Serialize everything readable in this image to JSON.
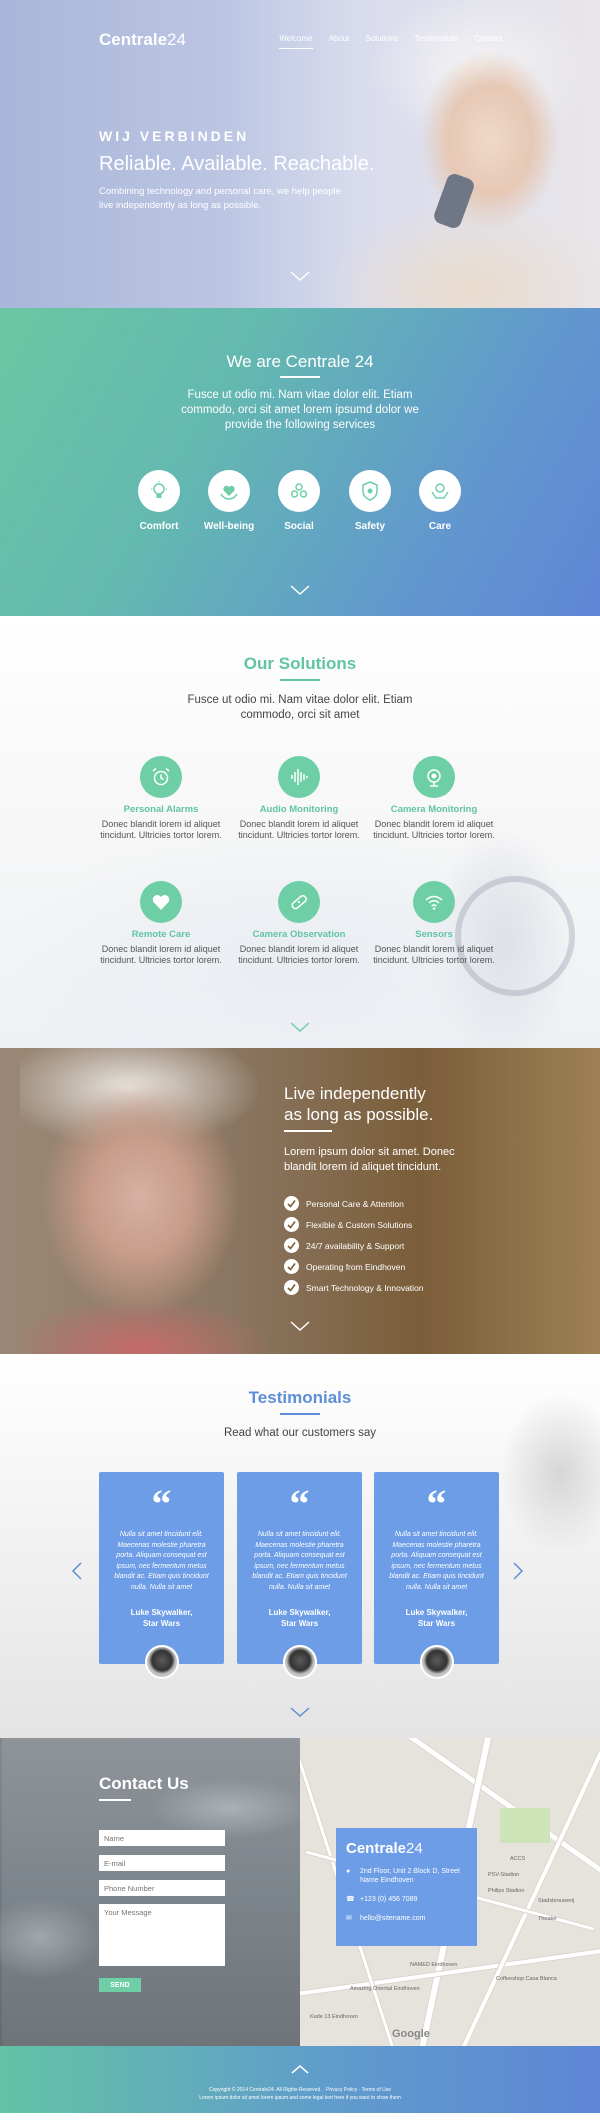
{
  "brand": {
    "bold": "Centrale",
    "light": "24"
  },
  "nav": [
    "Welcome",
    "About",
    "Solutions",
    "Testimonials",
    "Contact"
  ],
  "hero": {
    "kicker": "WIJ VERBINDEN",
    "headline": "Reliable. Available. Reachable.",
    "lead": "Combining technology and personal care, we help people live independently as long as possible."
  },
  "about": {
    "title": "We are Centrale 24",
    "description": "Fusce ut odio mi. Nam vitae dolor elit. Etiam commodo, orci sit amet lorem ipsumd dolor we provide the following services",
    "services": [
      {
        "label": "Comfort",
        "icon": "lightbulb-icon"
      },
      {
        "label": "Well-being",
        "icon": "heart-hands-icon"
      },
      {
        "label": "Social",
        "icon": "people-icon"
      },
      {
        "label": "Safety",
        "icon": "shield-icon"
      },
      {
        "label": "Care",
        "icon": "hands-icon"
      }
    ]
  },
  "solutions": {
    "title": "Our Solutions",
    "description": "Fusce ut odio mi. Nam vitae dolor elit. Etiam commodo, orci sit amet",
    "items": [
      {
        "title": "Personal Alarms",
        "text": "Donec blandit lorem id aliquet tincidunt. Ultricies tortor lorem.",
        "icon": "alarm-clock-icon"
      },
      {
        "title": "Audio Monitoring",
        "text": "Donec blandit lorem id aliquet tincidunt. Ultricies tortor lorem.",
        "icon": "soundwave-icon"
      },
      {
        "title": "Camera Monitoring",
        "text": "Donec blandit lorem id aliquet tincidunt. Ultricies tortor lorem.",
        "icon": "camera-icon"
      },
      {
        "title": "Remote Care",
        "text": "Donec blandit lorem id aliquet tincidunt. Ultricies tortor lorem.",
        "icon": "heart-icon"
      },
      {
        "title": "Camera Observation",
        "text": "Donec blandit lorem id aliquet tincidunt. Ultricies tortor lorem.",
        "icon": "bandage-icon"
      },
      {
        "title": "Sensors",
        "text": "Donec blandit lorem id aliquet tincidunt. Ultricies tortor lorem.",
        "icon": "wifi-icon"
      }
    ]
  },
  "live": {
    "title_line1": "Live independently",
    "title_line2": "as long as possible.",
    "lead": "Lorem ipsum dolor sit amet. Donec blandit lorem id aliquet tincidunt.",
    "features": [
      "Personal Care & Attention",
      "Flexible & Custom Solutions",
      "24/7 availability & Support",
      "Operating from Eindhoven",
      "Smart Technology & Innovation"
    ]
  },
  "testimonials": {
    "title": "Testimonials",
    "subtitle": "Read what our customers say",
    "cards": [
      {
        "text": "Nulla sit amet tincidunt elit. Maecenas molestie pharetra porta. Aliquam consequat est ipsum, nec fermentum metus blandit ac. Etiam quis tincidunt nulla. Nulla sit amet",
        "name_line1": "Luke Skywalker,",
        "name_line2": "Star Wars"
      },
      {
        "text": "Nulla sit amet tincidunt elit. Maecenas molestie pharetra porta. Aliquam consequat est ipsum, nec fermentum metus blandit ac. Etiam quis tincidunt nulla. Nulla sit amet",
        "name_line1": "Luke Skywalker,",
        "name_line2": "Star Wars"
      },
      {
        "text": "Nulla sit amet tincidunt elit. Maecenas molestie pharetra porta. Aliquam consequat est ipsum, nec fermentum metus blandit ac. Etiam quis tincidunt nulla. Nulla sit amet",
        "name_line1": "Luke Skywalker,",
        "name_line2": "Star Wars"
      }
    ]
  },
  "contact": {
    "title": "Contact Us",
    "placeholders": {
      "name": "Name",
      "email": "E-mail",
      "phone": "Phone Number",
      "message": "Your Message"
    },
    "send_label": "SEND",
    "info": {
      "address": "2nd Floor, Unit 2 Block D, Street Name Eindhoven",
      "phone": "+123 (0) 456 7089",
      "email": "hello@sitename.com"
    },
    "map_labels": [
      "ACCS",
      "PSV-Stadion",
      "Philips Stadion",
      "Stadsbrouwerij",
      "Theater",
      "Coffeeshop Casa Blanca",
      "Amazing Oriental Eindhoven",
      "Kade 13 Eindhoven",
      "NAMED Eindhoven",
      "Google"
    ]
  },
  "footer": {
    "copyright": "Copyright © 2014 Centrale24. All Rights Reserved. · Privacy Policy · Terms of Use",
    "note": "Lorem ipsum dolor sit amet lorem ipsum and some legal text here if you want to show them"
  },
  "colors": {
    "green": "#6ecfa7",
    "blue": "#6c9de6",
    "nav_text": "#ffffff"
  }
}
